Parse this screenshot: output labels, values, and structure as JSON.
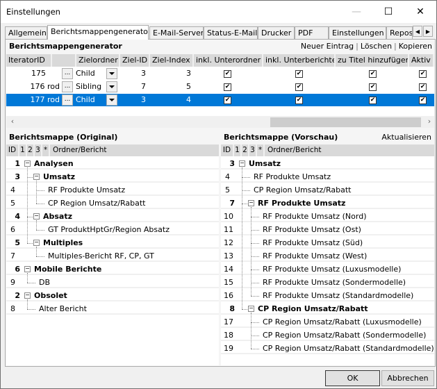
{
  "window": {
    "title": "Einstellungen",
    "minimize_icon": "minimize-icon",
    "maximize_icon": "maximize-icon",
    "close_icon": "close-icon"
  },
  "tabs": [
    {
      "label": "Allgemein",
      "active": false
    },
    {
      "label": "Berichtsmappengenerator",
      "active": true
    },
    {
      "label": "E-Mail-Server",
      "active": false
    },
    {
      "label": "Status-E-Mail",
      "active": false
    },
    {
      "label": "Drucker",
      "active": false
    },
    {
      "label": "PDF",
      "active": false
    },
    {
      "label": "Einstellungen",
      "active": false
    },
    {
      "label": "Repos",
      "active": false
    }
  ],
  "tab_scroll": {
    "left": "◀",
    "right": "▶"
  },
  "generator": {
    "title": "Berichtsmappengenerator",
    "actions": [
      "Neuer Eintrag",
      "Löschen",
      "Kopieren"
    ],
    "columns": [
      "IteratorID",
      "",
      "Zielordner",
      "Ziel-ID",
      "Ziel-Index",
      "inkl. Unterordner",
      "inkl. Unterberichte",
      "zu Titel hinzufügen",
      "Aktiv"
    ],
    "rows": [
      {
        "iterator_id": "175",
        "ellipsis": "...",
        "zielordner": "Child",
        "ziel_id": "3",
        "ziel_index": "3",
        "inkl_unterordner": true,
        "inkl_unterberichte": true,
        "zu_titel": true,
        "aktiv": true,
        "selected": false
      },
      {
        "iterator_id": "176 rod",
        "ellipsis": "...",
        "zielordner": "Sibling",
        "ziel_id": "7",
        "ziel_index": "5",
        "inkl_unterordner": true,
        "inkl_unterberichte": true,
        "zu_titel": true,
        "aktiv": true,
        "selected": false
      },
      {
        "iterator_id": "177 rod",
        "ellipsis": "...",
        "zielordner": "Child",
        "ziel_id": "3",
        "ziel_index": "4",
        "inkl_unterordner": true,
        "inkl_unterberichte": true,
        "zu_titel": true,
        "aktiv": true,
        "selected": true
      }
    ],
    "scroll_left": "‹",
    "scroll_right": "›",
    "checkmark": "✔"
  },
  "original": {
    "title": "Berichtsmappe (Original)",
    "columns": [
      "ID",
      "1",
      "2",
      "3",
      "*",
      "Ordner/Bericht"
    ],
    "items": [
      {
        "id": "1",
        "label": "Analysen",
        "folder": true,
        "level": 0
      },
      {
        "id": "3",
        "label": "Umsatz",
        "folder": true,
        "level": 1
      },
      {
        "id": "4",
        "label": "RF Produkte Umsatz",
        "folder": false,
        "level": 2
      },
      {
        "id": "5",
        "label": "CP Region Umsatz/Rabatt",
        "folder": false,
        "level": 2
      },
      {
        "id": "4",
        "label": "Absatz",
        "folder": true,
        "level": 1
      },
      {
        "id": "6",
        "label": "GT ProduktHptGr/Region Absatz",
        "folder": false,
        "level": 2
      },
      {
        "id": "5",
        "label": "Multiples",
        "folder": true,
        "level": 1
      },
      {
        "id": "7",
        "label": "Multiples-Bericht RF, CP, GT",
        "folder": false,
        "level": 2
      },
      {
        "id": "6",
        "label": "Mobile Berichte",
        "folder": true,
        "level": 0
      },
      {
        "id": "9",
        "label": "DB",
        "folder": false,
        "level": 1
      },
      {
        "id": "2",
        "label": "Obsolet",
        "folder": true,
        "level": 0
      },
      {
        "id": "8",
        "label": "Alter Bericht",
        "folder": false,
        "level": 1
      }
    ]
  },
  "preview": {
    "title": "Berichtsmappe (Vorschau)",
    "refresh_label": "Aktualisieren",
    "columns": [
      "ID",
      "1",
      "2",
      "3",
      "*",
      "Ordner/Bericht"
    ],
    "items": [
      {
        "id": "3",
        "label": "Umsatz",
        "folder": true,
        "level": 0
      },
      {
        "id": "4",
        "label": "RF Produkte Umsatz",
        "folder": false,
        "level": 1
      },
      {
        "id": "5",
        "label": "CP Region Umsatz/Rabatt",
        "folder": false,
        "level": 1
      },
      {
        "id": "7",
        "label": "RF Produkte Umsatz",
        "folder": true,
        "level": 1
      },
      {
        "id": "10",
        "label": "RF Produkte Umsatz (Nord)",
        "folder": false,
        "level": 2
      },
      {
        "id": "11",
        "label": "RF Produkte Umsatz (Ost)",
        "folder": false,
        "level": 2
      },
      {
        "id": "12",
        "label": "RF Produkte Umsatz (Süd)",
        "folder": false,
        "level": 2
      },
      {
        "id": "13",
        "label": "RF Produkte Umsatz (West)",
        "folder": false,
        "level": 2
      },
      {
        "id": "14",
        "label": "RF Produkte Umsatz (Luxusmodelle)",
        "folder": false,
        "level": 2
      },
      {
        "id": "15",
        "label": "RF Produkte Umsatz (Sondermodelle)",
        "folder": false,
        "level": 2
      },
      {
        "id": "16",
        "label": "RF Produkte Umsatz (Standardmodelle)",
        "folder": false,
        "level": 2
      },
      {
        "id": "8",
        "label": "CP Region Umsatz/Rabatt",
        "folder": true,
        "level": 1
      },
      {
        "id": "17",
        "label": "CP Region Umsatz/Rabatt (Luxusmodelle)",
        "folder": false,
        "level": 2
      },
      {
        "id": "18",
        "label": "CP Region Umsatz/Rabatt (Sondermodelle)",
        "folder": false,
        "level": 2
      },
      {
        "id": "19",
        "label": "CP Region Umsatz/Rabatt (Standardmodelle)",
        "folder": false,
        "level": 2
      }
    ]
  },
  "buttons": {
    "ok": "OK",
    "cancel": "Abbrechen"
  },
  "colors": {
    "selection": "#0078d7",
    "header_bg": "#d9d9d9",
    "dialog_bg": "#f0f0f0"
  }
}
